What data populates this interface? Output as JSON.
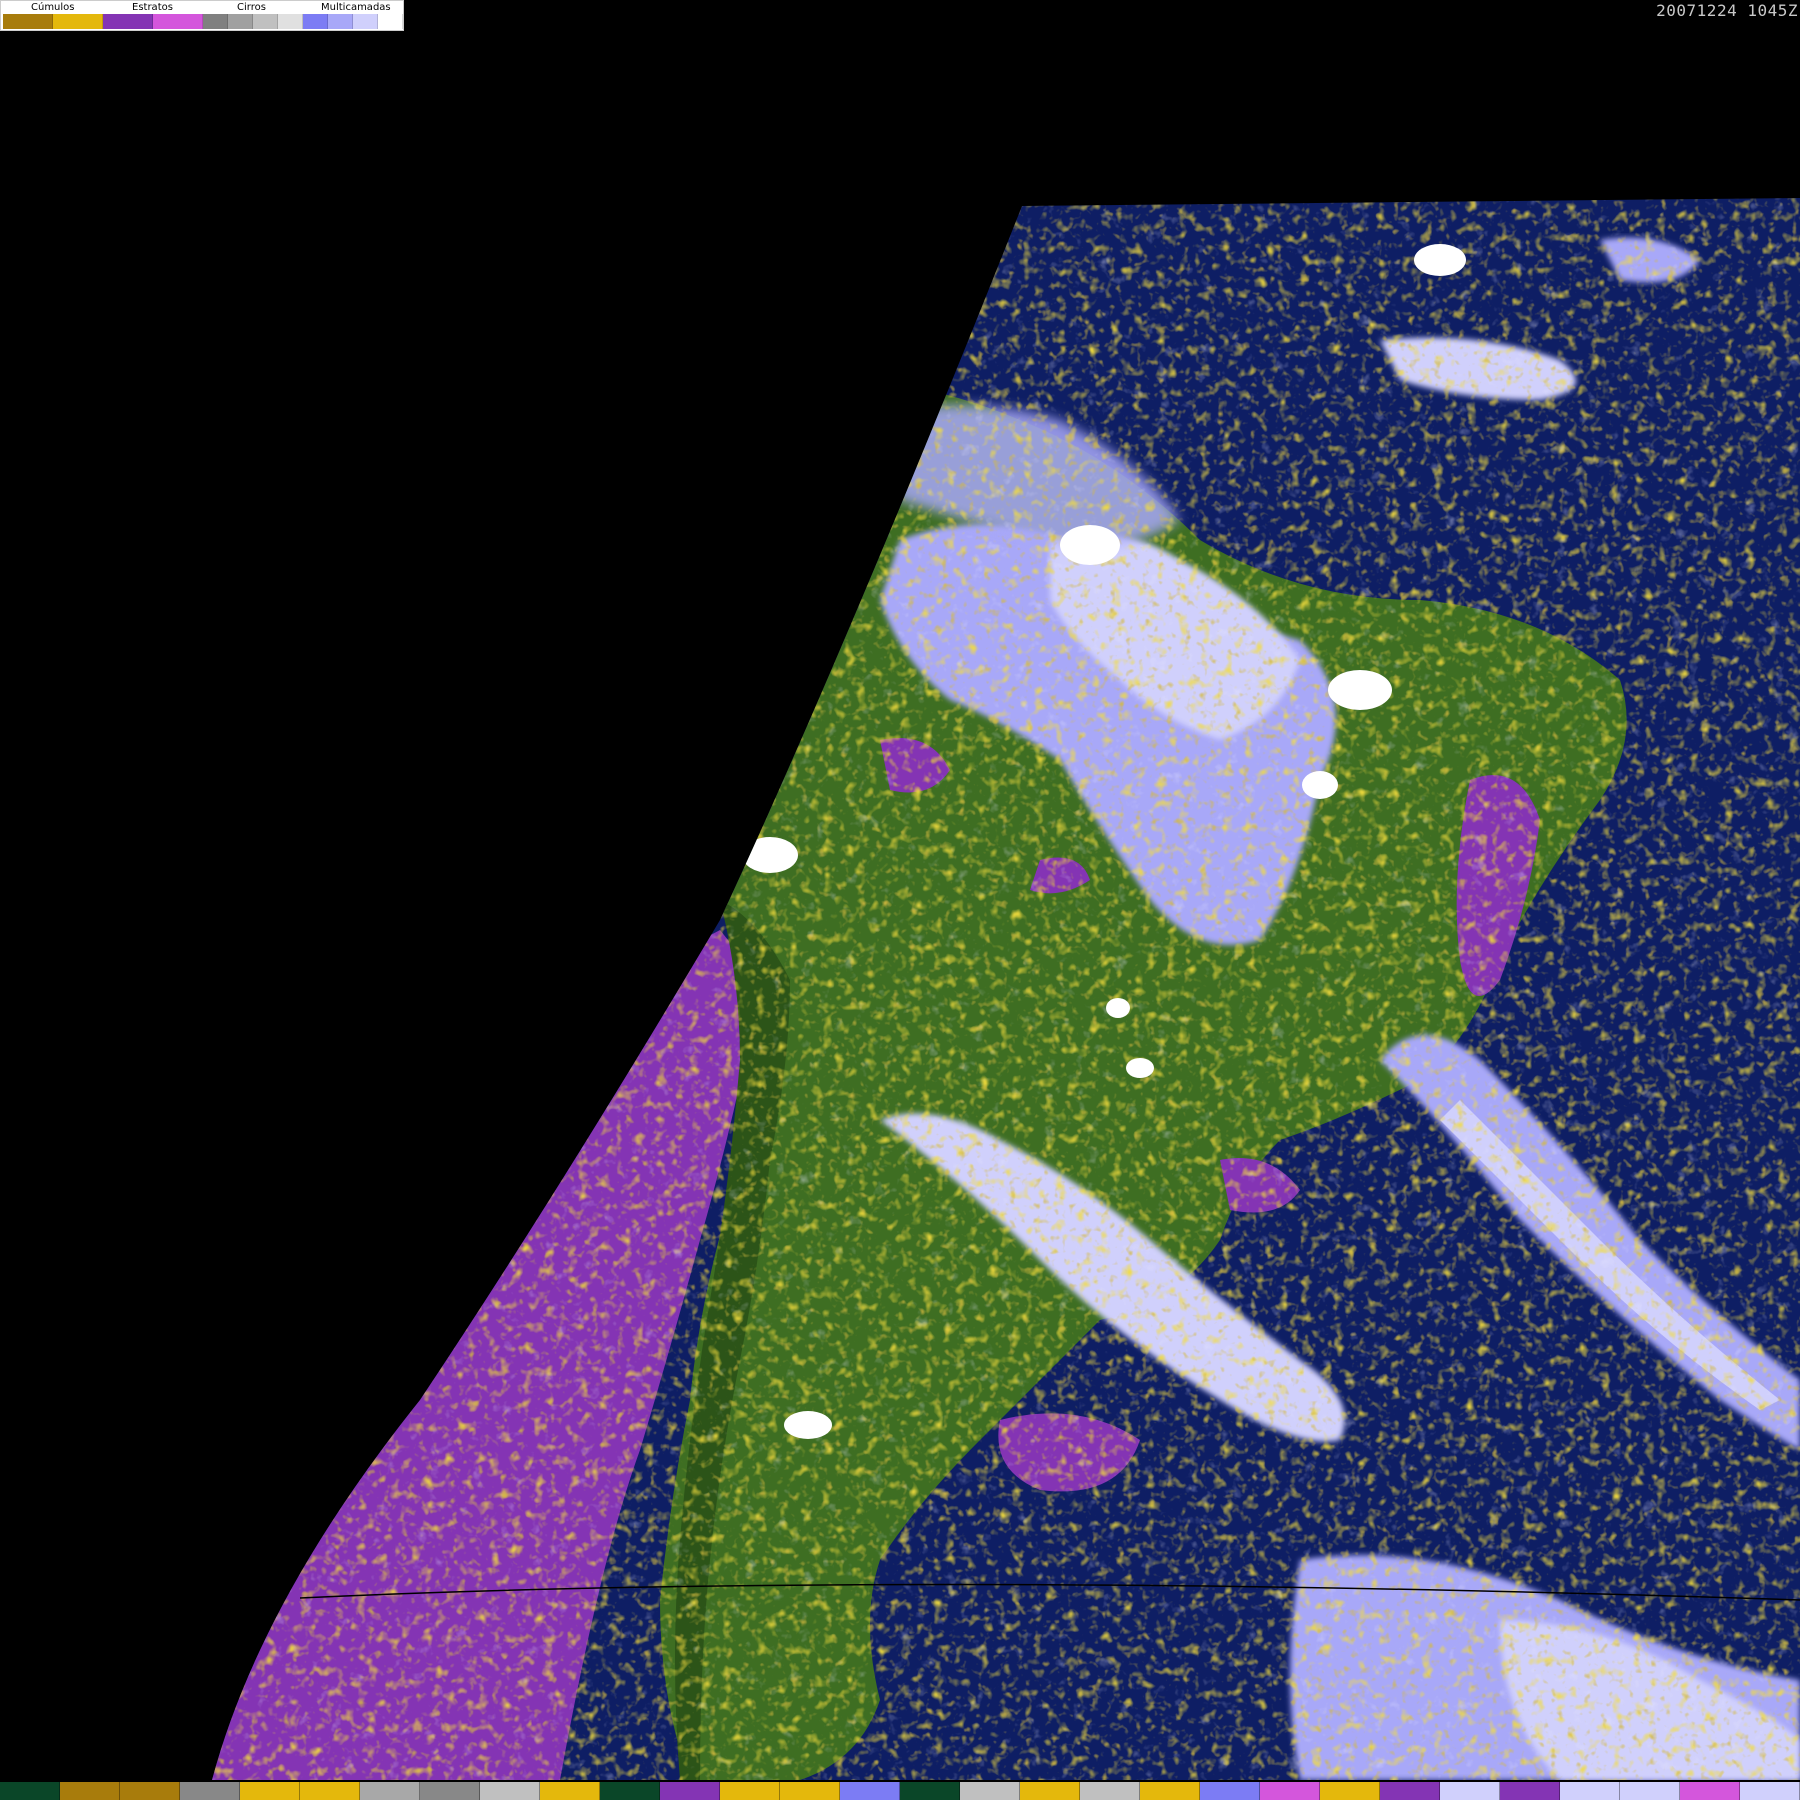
{
  "legend": {
    "groups": [
      {
        "label": "Cúmulos",
        "swatches": [
          "#a87c0c",
          "#e4b80c"
        ]
      },
      {
        "label": "Estratos",
        "swatches": [
          "#8434b4",
          "#d456dc"
        ]
      },
      {
        "label": "Cirros",
        "swatches": [
          "#808080",
          "#a0a0a0",
          "#c0c0c0",
          "#e0e0e0"
        ]
      },
      {
        "label": "Multicamadas",
        "swatches": [
          "#7c7cf4",
          "#a8a8f8",
          "#d0d0fc",
          "#ffffff"
        ]
      }
    ]
  },
  "timestamp": "20071224 1045Z",
  "map": {
    "colors": {
      "space": "#000000",
      "ocean": "#0e1e64",
      "land": "#3e6e22",
      "land_dark": "#2c5418",
      "stratus": "#8434b4",
      "stratus_light": "#d456dc",
      "cumulus": "#e4b80c",
      "cumulus_dark": "#a87c0c",
      "cirrus": "#c0c0c0",
      "multilayer": "#a8a8f8",
      "multilayer_light": "#d0d0fc",
      "grid_line": "#000000"
    }
  },
  "bottom_strip": [
    "#0a4628",
    "#a87c0c",
    "#a87c0c",
    "#888888",
    "#e4b80c",
    "#e4b80c",
    "#a8a8a8",
    "#888888",
    "#c0c0c0",
    "#e4b80c",
    "#0a4628",
    "#8434b4",
    "#e4b80c",
    "#e4b80c",
    "#7c7cf4",
    "#0a4628",
    "#c0c0c0",
    "#e4b80c",
    "#c0c0c0",
    "#e4b80c",
    "#7c7cf4",
    "#d456dc",
    "#e4b80c",
    "#8434b4",
    "#d0d0fc",
    "#8434b4",
    "#d0d0fc",
    "#d0d0fc",
    "#d456dc",
    "#d0d0fc"
  ]
}
